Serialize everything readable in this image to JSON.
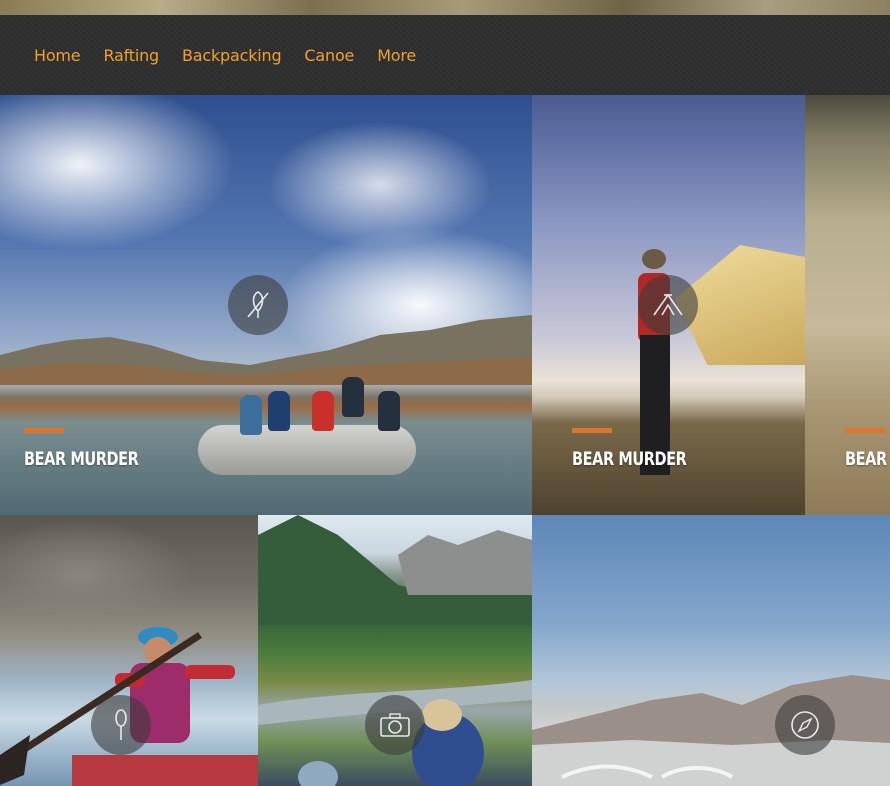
{
  "nav": {
    "items": [
      {
        "label": "Home"
      },
      {
        "label": "Rafting"
      },
      {
        "label": "Backpacking"
      },
      {
        "label": "Canoe"
      },
      {
        "label": "More"
      }
    ]
  },
  "tiles": [
    {
      "title": "BEAR MURDER",
      "icon": "no-fishing-icon"
    },
    {
      "title": "BEAR MURDER",
      "icon": "tent-icon"
    },
    {
      "title": "BEAR",
      "icon": null
    },
    {
      "title": "",
      "icon": "paddle-icon"
    },
    {
      "title": "",
      "icon": "camera-icon"
    },
    {
      "title": "",
      "icon": "compass-icon"
    }
  ],
  "colors": {
    "nav_bg": "#2f2f2f",
    "nav_link": "#f0a033",
    "accent": "#e0742a",
    "title_text": "#ffffff"
  }
}
